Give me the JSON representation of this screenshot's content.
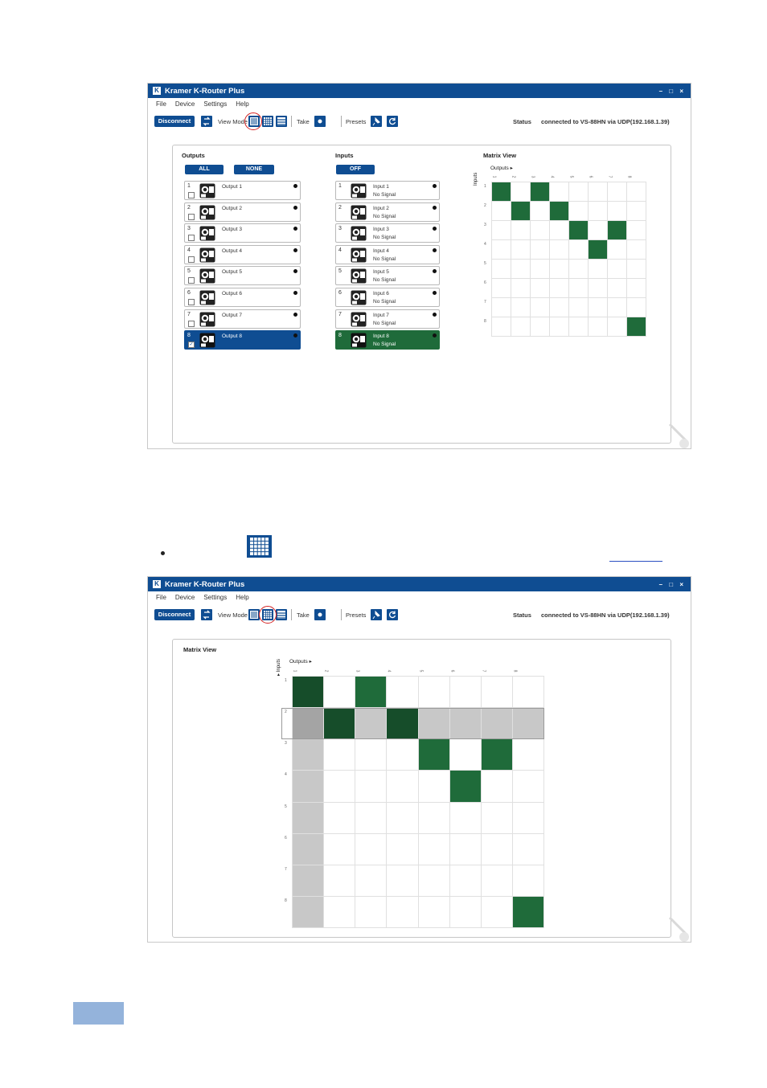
{
  "app": {
    "title": "Kramer K-Router Plus",
    "window_controls": "– □ ×",
    "menu": [
      "File",
      "Device",
      "Settings",
      "Help"
    ],
    "toolbar": {
      "disconnect": "Disconnect",
      "view_mode": "View Mode",
      "take": "Take",
      "presets": "Presets",
      "status_label": "Status",
      "status_text": "connected to VS-88HN   via UDP(192.168.1.39)"
    }
  },
  "screen1": {
    "outputs_header": "Outputs",
    "inputs_header": "Inputs",
    "matrix_header": "Matrix View",
    "all_button": "ALL",
    "none_button": "NONE",
    "off_button": "OFF",
    "outputs": [
      {
        "num": "1",
        "label": "Output 1",
        "checked": false
      },
      {
        "num": "2",
        "label": "Output 2",
        "checked": false
      },
      {
        "num": "3",
        "label": "Output 3",
        "checked": false
      },
      {
        "num": "4",
        "label": "Output 4",
        "checked": false
      },
      {
        "num": "5",
        "label": "Output 5",
        "checked": false
      },
      {
        "num": "6",
        "label": "Output 6",
        "checked": false
      },
      {
        "num": "7",
        "label": "Output 7",
        "checked": false
      },
      {
        "num": "8",
        "label": "Output 8",
        "checked": true
      }
    ],
    "inputs": [
      {
        "num": "1",
        "label": "Input 1",
        "signal": "No Signal"
      },
      {
        "num": "2",
        "label": "Input 2",
        "signal": "No Signal"
      },
      {
        "num": "3",
        "label": "Input 3",
        "signal": "No Signal"
      },
      {
        "num": "4",
        "label": "Input 4",
        "signal": "No Signal"
      },
      {
        "num": "5",
        "label": "Input 5",
        "signal": "No Signal"
      },
      {
        "num": "6",
        "label": "Input 6",
        "signal": "No Signal"
      },
      {
        "num": "7",
        "label": "Input 7",
        "signal": "No Signal"
      },
      {
        "num": "8",
        "label": "Input 8",
        "signal": "No Signal"
      }
    ],
    "selected_output": 8,
    "selected_input": 8
  },
  "screen2": {
    "matrix_header": "Matrix View",
    "highlight_row": 2,
    "highlight_col": 1
  },
  "matrix": {
    "outputs_label": "Outputs",
    "inputs_label": "Inputs",
    "ticks": [
      "1",
      "2",
      "3",
      "4",
      "5",
      "6",
      "7",
      "8"
    ],
    "routes": [
      {
        "input": 1,
        "output": 1
      },
      {
        "input": 1,
        "output": 3
      },
      {
        "input": 2,
        "output": 2
      },
      {
        "input": 2,
        "output": 4
      },
      {
        "input": 3,
        "output": 5
      },
      {
        "input": 3,
        "output": 7
      },
      {
        "input": 4,
        "output": 6
      },
      {
        "input": 8,
        "output": 8
      }
    ]
  },
  "colors": {
    "brand_blue": "#0f4d92",
    "route_green": "#1f6b3a",
    "highlight_gray": "#c8c8c8",
    "selection_ring": "#d32020"
  }
}
